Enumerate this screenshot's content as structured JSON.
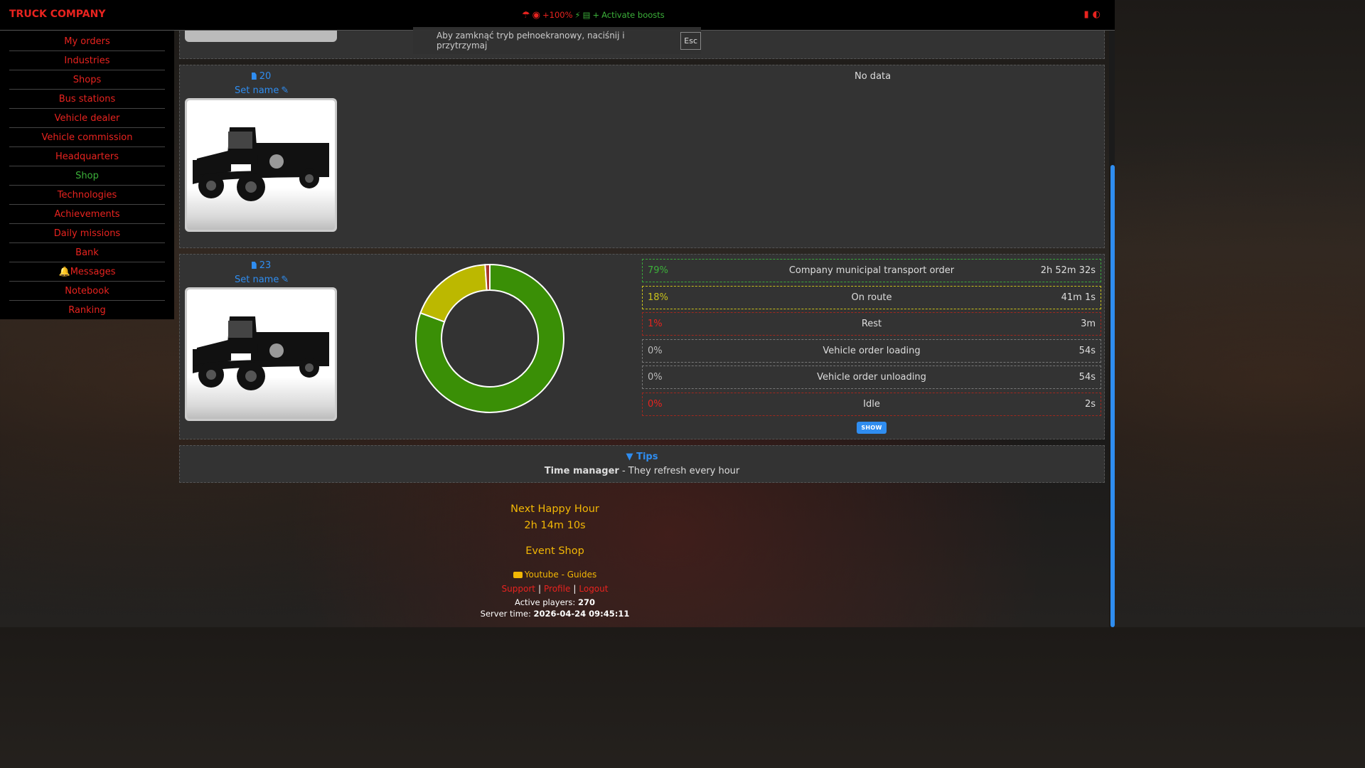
{
  "header": {
    "brand": "TRUCK COMPANY",
    "boost_percent": "+100%",
    "boost_action": "Activate boosts"
  },
  "fullscreen_notice": {
    "text": "Aby zamknąć tryb pełnoekranowy, naciśnij i przytrzymaj",
    "key": "Esc"
  },
  "sidebar": {
    "items": [
      {
        "label": "My orders"
      },
      {
        "label": "Industries"
      },
      {
        "label": "Shops"
      },
      {
        "label": "Bus stations"
      },
      {
        "label": "Vehicle dealer"
      },
      {
        "label": "Vehicle commission"
      },
      {
        "label": "Headquarters"
      },
      {
        "label": "Shop"
      },
      {
        "label": "Technologies"
      },
      {
        "label": "Achievements"
      },
      {
        "label": "Daily missions"
      },
      {
        "label": "Bank"
      },
      {
        "label": "Messages"
      },
      {
        "label": "Notebook"
      },
      {
        "label": "Ranking"
      }
    ]
  },
  "vehicles": [
    {
      "id": "20",
      "set_name": "Set name",
      "no_data": "No data"
    },
    {
      "id": "23",
      "set_name": "Set name",
      "stats": [
        {
          "pct": "79%",
          "label": "Company municipal transport order",
          "duration": "2h 52m 32s",
          "color": "#3cb13a"
        },
        {
          "pct": "18%",
          "label": "On route",
          "duration": "41m 1s",
          "color": "#c9c21c"
        },
        {
          "pct": "1%",
          "label": "Rest",
          "duration": "3m",
          "color": "#e8231f"
        },
        {
          "pct": "0%",
          "label": "Vehicle order loading",
          "duration": "54s",
          "color": "#bbbbbb"
        },
        {
          "pct": "0%",
          "label": "Vehicle order unloading",
          "duration": "54s",
          "color": "#bbbbbb"
        },
        {
          "pct": "0%",
          "label": "Idle",
          "duration": "2s",
          "color": "#e8231f"
        }
      ],
      "show_label": "SHOW"
    }
  ],
  "chart_data": {
    "type": "pie",
    "donut": true,
    "categories": [
      "Company municipal transport order",
      "On route",
      "Rest",
      "Vehicle order loading",
      "Vehicle order unloading",
      "Idle"
    ],
    "values": [
      79,
      18,
      1,
      0,
      0,
      0
    ],
    "colors": [
      "#3a8f06",
      "#bcb800",
      "#a8372b",
      "#888888",
      "#888888",
      "#a8372b"
    ]
  },
  "tips": {
    "title": "Tips",
    "bold": "Time manager",
    "text": " - They refresh every hour"
  },
  "footer": {
    "happy_hour_title": "Next Happy Hour",
    "happy_hour_time": "2h 14m 10s",
    "event_shop": "Event Shop",
    "youtube": "Youtube - Guides",
    "links": {
      "support": "Support",
      "profile": "Profile",
      "logout": "Logout"
    },
    "active_players_label": "Active players: ",
    "active_players_value": "270",
    "server_time_label": "Server time: ",
    "server_time_value": "2026-04-24 09:45:11"
  }
}
